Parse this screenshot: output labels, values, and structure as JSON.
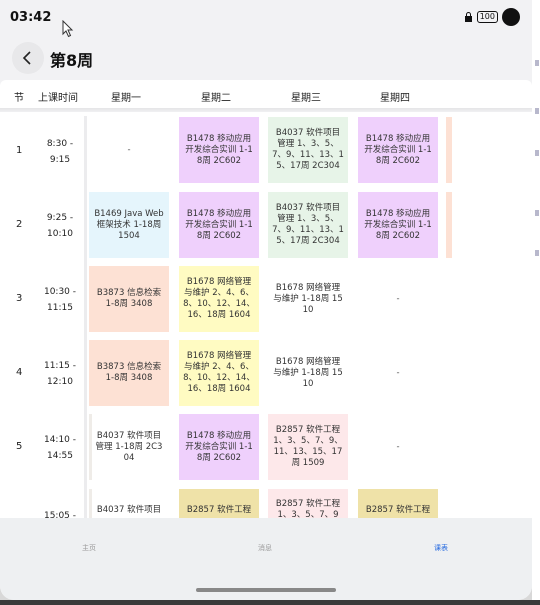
{
  "status_bar": {
    "time": "03:42",
    "battery": "100"
  },
  "header": {
    "title": "第8周"
  },
  "day_header": {
    "col_section": "节",
    "col_time": "上课时间",
    "days": [
      "星期一",
      "星期二",
      "星期三",
      "星期四"
    ]
  },
  "rows": [
    {
      "num": "1",
      "time": "8:30 - 9:15",
      "cells": [
        "-",
        "B1478 移动应用开发综合实训 1-18周 2C602",
        "B4037 软件项目管理 1、3、5、7、9、11、13、15、17周 2C304",
        "B1478 移动应用开发综合实训 1-18周 2C602"
      ]
    },
    {
      "num": "2",
      "time": "9:25 - 10:10",
      "cells": [
        "B1469 Java Web框架技术 1-18周 1504",
        "B1478 移动应用开发综合实训 1-18周 2C602",
        "B4037 软件项目管理 1、3、5、7、9、11、13、15、17周 2C304",
        "B1478 移动应用开发综合实训 1-18周 2C602"
      ]
    },
    {
      "num": "3",
      "time": "10:30 - 11:15",
      "cells": [
        "B3873 信息检索 1-8周 3408",
        "B1678 网络管理与维护 2、4、6、8、10、12、14、16、18周 1604",
        "B1678 网络管理与维护 1-18周 1510",
        "-"
      ]
    },
    {
      "num": "4",
      "time": "11:15 - 12:10",
      "cells": [
        "B3873 信息检索 1-8周 3408",
        "B1678 网络管理与维护 2、4、6、8、10、12、14、16、18周 1604",
        "B1678 网络管理与维护 1-18周 1510",
        "-"
      ]
    },
    {
      "num": "5",
      "time": "14:10 - 14:55",
      "cells": [
        "B4037 软件项目管理 1-18周 2C304",
        "B1478 移动应用开发综合实训 1-18周 2C602",
        "B2857 软件工程 1、3、5、7、9、11、13、15、17周 1509",
        "-"
      ]
    },
    {
      "num": "",
      "time": "15:05 -",
      "cells": [
        "B4037 软件项目",
        "B2857 软件工程",
        "B2857 软件工程 1、3、5、7、9",
        "B2857 软件工程"
      ]
    }
  ],
  "nav": {
    "home": "主页",
    "messages": "消息",
    "schedule": "课表"
  },
  "colors": {
    "active_tab": "#2a6de0",
    "purple_card": "#efd0fc",
    "green_card": "#e7f4e8",
    "peach_card": "#fde1d4",
    "yellow_card": "#fffbc2"
  }
}
